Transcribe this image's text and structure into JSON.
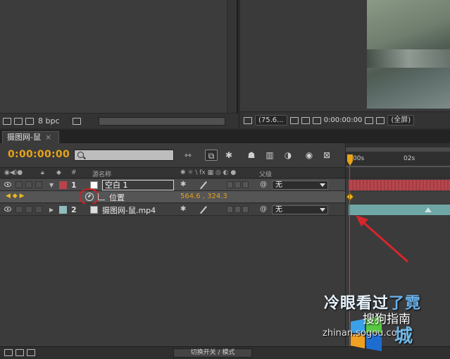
{
  "project": {
    "bpc_label": "8 bpc"
  },
  "viewer": {
    "zoom": "(75.6...",
    "timecode": "0:00:00:00",
    "resolution": "(全屏)"
  },
  "timeline": {
    "tab_name": "摄图网-鼠",
    "current_time": "0:00:00:00",
    "ruler_labels": [
      "00s",
      "02s"
    ],
    "columns": {
      "source_name": "源名称",
      "parent": "父级",
      "num": "#"
    },
    "layers": [
      {
        "num": "1",
        "name": "空白 1",
        "color": "#b8434c",
        "parent": "无"
      },
      {
        "num": "2",
        "name": "摄图网-鼠.mp4",
        "color": "#8fbcbc",
        "parent": "无"
      }
    ],
    "property": {
      "name": "位置",
      "value": "564.6 , 324.3"
    },
    "toggle_label": "切换开关 / 模式"
  },
  "watermark": {
    "text_main": "冷眼看过",
    "text_accent": "了霓",
    "sogou": "搜狗指南",
    "site": "zhinan.sogou.com",
    "cheng": "城"
  }
}
